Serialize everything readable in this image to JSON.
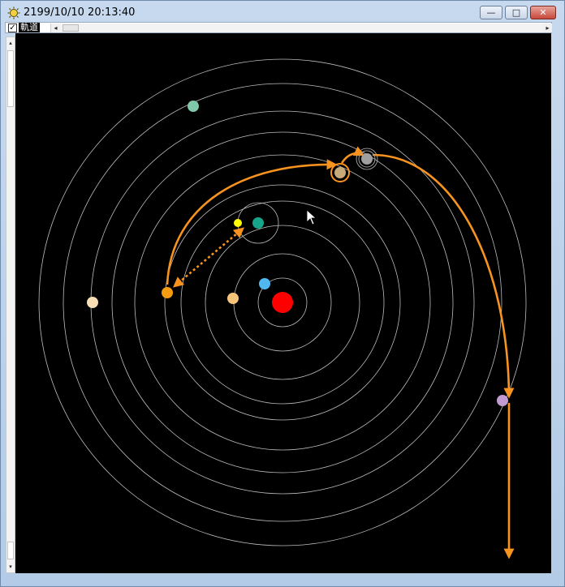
{
  "window": {
    "title": "2199/10/10 20:13:40",
    "controls": {
      "minimize": "—",
      "maximize": "□",
      "close": "✕"
    }
  },
  "toolbar": {
    "orbit_checkbox": {
      "checked": true,
      "mark": "✓",
      "label": "軌道"
    },
    "scroll_left": "◂",
    "scroll_right": "▸"
  },
  "vscroll": {
    "up": "▴",
    "down": "▾"
  },
  "map": {
    "sun_color": "#ff0000",
    "orbit_color": "#bdbdbd",
    "route_color": "#f7931e",
    "bodies": [
      {
        "name": "planet-light-blue",
        "color": "#4fb8f0"
      },
      {
        "name": "planet-peach",
        "color": "#f7c57a"
      },
      {
        "name": "planet-teal",
        "color": "#17a589"
      },
      {
        "name": "moon-yellow",
        "color": "#ffff00"
      },
      {
        "name": "planet-orange",
        "color": "#f39c12"
      },
      {
        "name": "planet-tan",
        "color": "#c8a97a"
      },
      {
        "name": "planet-gray",
        "color": "#a0a0a0"
      },
      {
        "name": "planet-pale-peach",
        "color": "#f8deb4"
      },
      {
        "name": "planet-violet",
        "color": "#c39bd3"
      },
      {
        "name": "planet-mint",
        "color": "#7fc8a9"
      }
    ]
  }
}
